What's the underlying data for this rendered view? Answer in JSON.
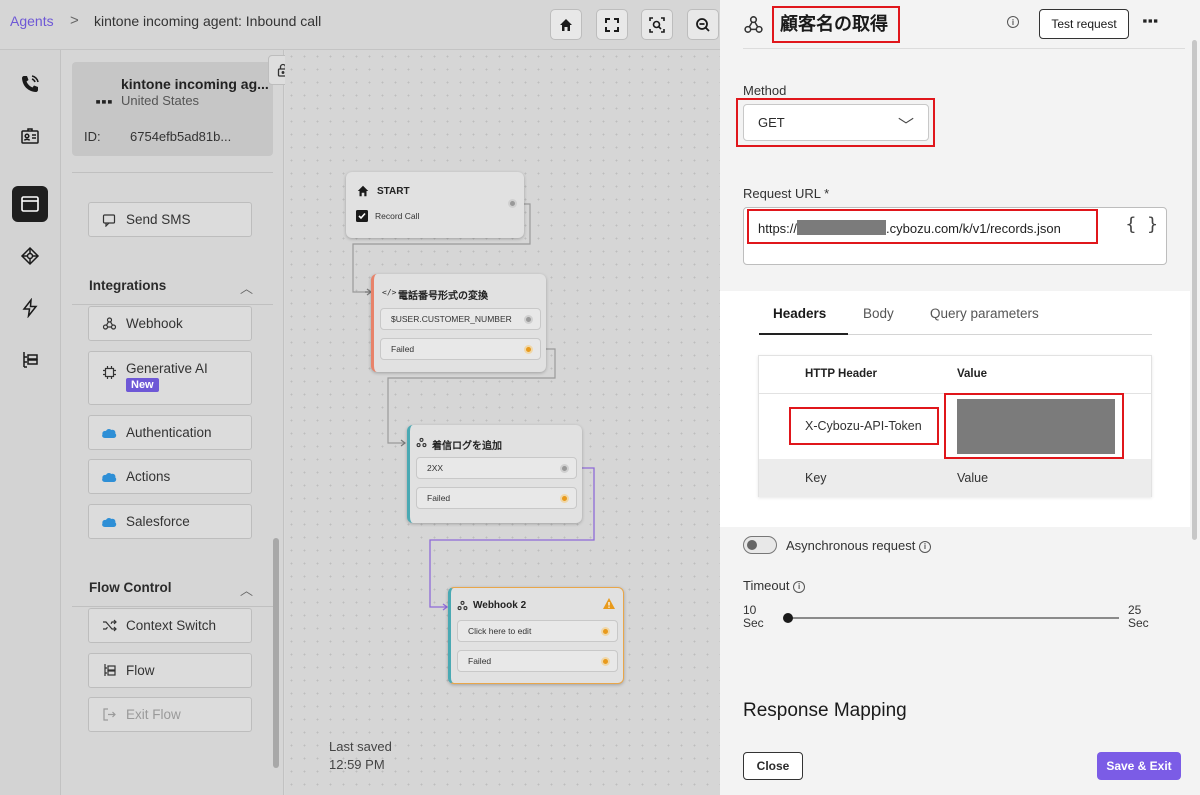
{
  "header": {
    "breadcrumb_root": "Agents",
    "breadcrumb_separator": ">",
    "breadcrumb_title": "kintone incoming agent: Inbound call"
  },
  "agent": {
    "name": "kintone incoming ag...",
    "country": "United States",
    "id_label": "ID:",
    "id_value": "6754efb5ad81b..."
  },
  "sidebar": {
    "send_sms": "Send SMS",
    "integrations": {
      "title": "Integrations",
      "items": [
        "Webhook",
        "Generative AI",
        "Authentication",
        "Actions",
        "Salesforce"
      ],
      "new_badge": "New"
    },
    "flow_control": {
      "title": "Flow Control",
      "items": [
        "Context Switch",
        "Flow",
        "Exit Flow"
      ]
    }
  },
  "canvas": {
    "nodes": {
      "start": {
        "title": "START",
        "row": "Record Call"
      },
      "convert": {
        "title": "電話番号形式の変換",
        "rows": [
          "$USER.CUSTOMER_NUMBER",
          "Failed"
        ]
      },
      "log": {
        "title": "着信ログを追加",
        "rows": [
          "2XX",
          "Failed"
        ]
      },
      "webhook2": {
        "title": "Webhook 2",
        "rows": [
          "Click here to edit",
          "Failed"
        ]
      }
    },
    "last_saved_label": "Last saved",
    "last_saved_time": "12:59 PM"
  },
  "drawer": {
    "title": "顧客名の取得",
    "test_request": "Test request",
    "method_label": "Method",
    "method_value": "GET",
    "url_label": "Request URL *",
    "url_prefix": "https://",
    "url_suffix": ".cybozu.com/k/v1/records.json",
    "braces": "{ }",
    "tabs": [
      "Headers",
      "Body",
      "Query parameters"
    ],
    "table": {
      "col_header": "HTTP Header",
      "col_value": "Value",
      "row_header": "X-Cybozu-API-Token",
      "empty_key": "Key",
      "empty_value": "Value"
    },
    "async_label": "Asynchronous request",
    "timeout_label": "Timeout",
    "timeout_min": "10",
    "timeout_max": "25",
    "timeout_unit": "Sec",
    "timeout_value": 10,
    "response_mapping": "Response Mapping",
    "close": "Close",
    "save_exit": "Save & Exit"
  },
  "colors": {
    "accent": "#7b5ce6",
    "highlight": "#e0161b",
    "orange_port": "#e89a1c"
  }
}
